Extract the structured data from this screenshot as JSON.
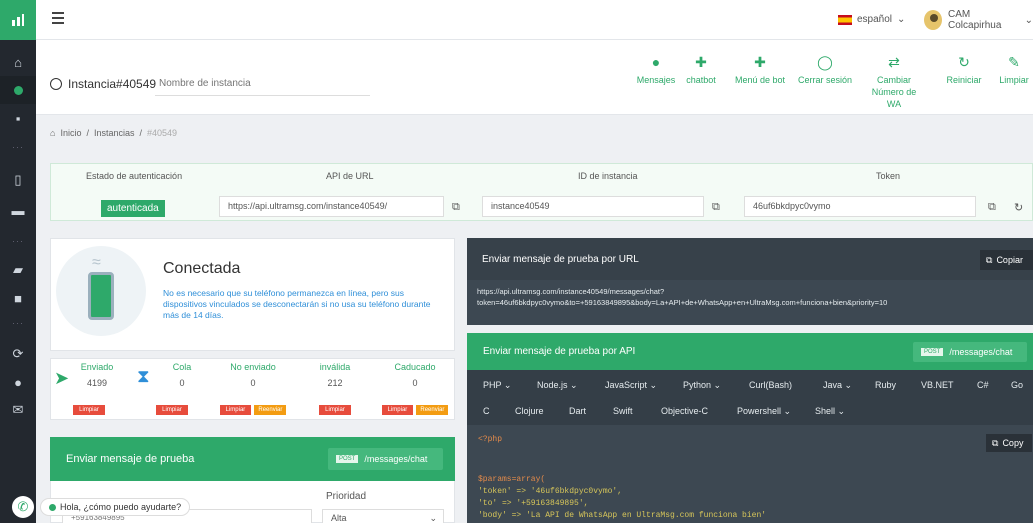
{
  "instance": {
    "title": "Instancia#40549",
    "name_placeholder": "Nombre de instancia"
  },
  "header": {
    "lang": "español",
    "user": "CAM Colcapirhua"
  },
  "actions": [
    {
      "label": "Mensajes",
      "icon": "chat-icon"
    },
    {
      "label": "chatbot",
      "icon": "bot-icon"
    },
    {
      "label": "Menú de bot",
      "icon": "bot-menu-icon"
    },
    {
      "label": "Cerrar sesión",
      "icon": "logout-icon"
    },
    {
      "label": "Cambiar Número de WA",
      "icon": "swap-icon"
    },
    {
      "label": "Reiniciar",
      "icon": "refresh-icon"
    },
    {
      "label": "Limpiar",
      "icon": "broom-icon"
    }
  ],
  "breadcrumb": [
    "Inicio",
    "/",
    "Instancias",
    "/",
    "#40549"
  ],
  "auth_table": {
    "headers": [
      "Estado de autenticación",
      "API de URL",
      "ID de instancia",
      "Token"
    ],
    "status": "autenticada",
    "api_url": "https://api.ultramsg.com/instance40549/",
    "instance_id": "instance40549",
    "token": "46uf6bkdpyc0vymo"
  },
  "connection": {
    "title": "Conectada",
    "text": "No es necesario que su teléfono permanezca en línea, pero sus dispositivos vinculados se desconectarán si no usa su teléfono durante más de 14 días."
  },
  "stats": [
    {
      "label": "Enviado",
      "value": "4199",
      "btn": "Limpiar"
    },
    {
      "label": "Cola",
      "value": "0",
      "btn": "Limpiar"
    },
    {
      "label": "No enviado",
      "value": "0",
      "btn": "Limpiar",
      "btn2": "Reenviar"
    },
    {
      "label": "inválida",
      "value": "212",
      "btn": "Limpiar"
    },
    {
      "label": "Caducado",
      "value": "0",
      "btn": "Limpiar",
      "btn2": "Reenviar"
    }
  ],
  "test_message": {
    "title": "Enviar mensaje de prueba",
    "method": "POST",
    "endpoint": "/messages/chat",
    "priority_label": "Prioridad",
    "priority_value": "Alta",
    "phone": "+59163849895"
  },
  "url_test": {
    "title": "Enviar mensaje de prueba por URL",
    "copy": "Copiar",
    "url_line1": "https://api.ultramsg.com/instance40549/messages/chat?",
    "url_line2": "token=46uf6bkdpyc0vymo&to=+59163849895&body=La+API+de+WhatsApp+en+UltraMsg.com+funciona+bien&priority=10"
  },
  "api_test": {
    "title": "Enviar mensaje de prueba por API",
    "method": "POST",
    "endpoint": "/messages/chat",
    "tabs1": [
      "PHP ⌄",
      "Node.js ⌄",
      "JavaScript ⌄",
      "Python ⌄",
      "Curl(Bash)",
      "Java ⌄",
      "Ruby",
      "VB.NET",
      "C#",
      "Go"
    ],
    "tabs2": [
      "C",
      "Clojure",
      "Dart",
      "Swift",
      "Objective-C",
      "Powershell ⌄",
      "Shell ⌄"
    ],
    "copy": "Copy",
    "code": [
      "<?php",
      "",
      "$params=array(",
      "'token' => '46uf6bkdpyc0vymo',",
      "'to' => '+59163849895',",
      "'body' => 'La API de WhatsApp en UltraMsg.com funciona bien'"
    ]
  },
  "chat": {
    "text": "Hola, ¿cómo puedo ayudarte?"
  }
}
